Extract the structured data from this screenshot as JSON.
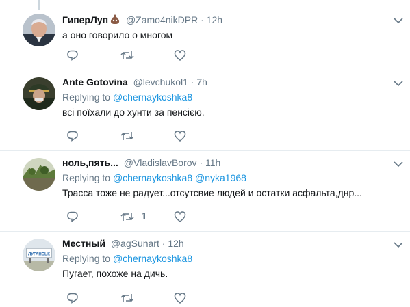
{
  "tweets": [
    {
      "fullname": "ГиперЛуп",
      "emoji": "pile-of-poo-emoji",
      "username": "@Zamo4nikDPR",
      "separator": "·",
      "time": "12h",
      "replying_prefix": "",
      "mentions": [],
      "text": "а оно говорило о многом",
      "retweet_count": ""
    },
    {
      "fullname": "Ante Gotovina",
      "username": "@levchukol1",
      "separator": "·",
      "time": "7h",
      "replying_prefix": "Replying to",
      "mentions": [
        "@chernaykoshka8"
      ],
      "text": "всі поїхали до хунти за пенсією.",
      "retweet_count": ""
    },
    {
      "fullname": "ноль,пять...",
      "username": "@VladislavBorov",
      "separator": "·",
      "time": "11h",
      "replying_prefix": "Replying to",
      "mentions": [
        "@chernaykoshka8",
        "@nyka1968"
      ],
      "text": "Трасса тоже не радует...отсутсвие людей и остатки асфальта,днр...",
      "retweet_count": "1"
    },
    {
      "fullname": "Местный",
      "username": "@agSunart",
      "separator": "·",
      "time": "12h",
      "replying_prefix": "Replying to",
      "mentions": [
        "@chernaykoshka8"
      ],
      "text": "Пугает, похоже на дичь.",
      "retweet_count": ""
    }
  ],
  "avatar4_sign_text": "ЛУГАНСЬК",
  "icons": {
    "reply": "reply-icon",
    "retweet": "retweet-icon",
    "like": "like-icon",
    "caret": "chevron-down-icon"
  },
  "colors": {
    "text": "#14171a",
    "secondary": "#657786",
    "link": "#1b95e0",
    "divider": "#e6ecf0"
  }
}
